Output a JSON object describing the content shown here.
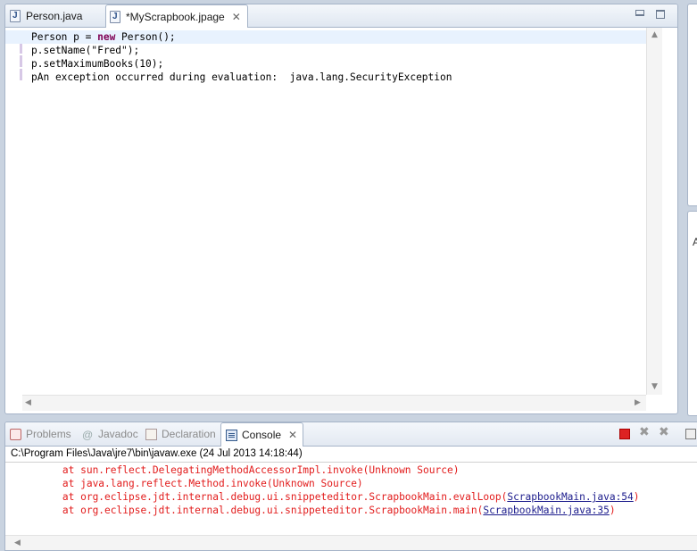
{
  "editor": {
    "tabs": [
      {
        "label": "Person.java",
        "active": false
      },
      {
        "label": "*MyScrapbook.jpage",
        "active": true
      }
    ],
    "code_lines": [
      {
        "before": "Person p = ",
        "keyword": "new",
        "after": " Person();"
      },
      {
        "text": "p.setName(\"Fred\");"
      },
      {
        "text": "p.setMaximumBooks(10);"
      },
      {
        "text": "pAn exception occurred during evaluation:  java.lang.SecurityException"
      }
    ]
  },
  "right_edge": {
    "letter": "A"
  },
  "console_view": {
    "tabs": [
      {
        "label": "Problems",
        "active": false
      },
      {
        "label": "Javadoc",
        "active": false
      },
      {
        "label": "Declaration",
        "active": false
      },
      {
        "label": "Console",
        "active": true
      }
    ],
    "launch_info": "C:\\Program Files\\Java\\jre7\\bin\\javaw.exe (24 Jul 2013 14:18:44)",
    "stack_lines": [
      {
        "prefix": "at sun.reflect.DelegatingMethodAccessorImpl.invoke(Unknown Source)",
        "link": "",
        "suffix": ""
      },
      {
        "prefix": "at java.lang.reflect.Method.invoke(Unknown Source)",
        "link": "",
        "suffix": ""
      },
      {
        "prefix": "at org.eclipse.jdt.internal.debug.ui.snippeteditor.ScrapbookMain.evalLoop(",
        "link": "ScrapbookMain.java:54",
        "suffix": ")"
      },
      {
        "prefix": "at org.eclipse.jdt.internal.debug.ui.snippeteditor.ScrapbookMain.main(",
        "link": "ScrapbookMain.java:35",
        "suffix": ")"
      }
    ],
    "colors": {
      "error_text": "#e21b1b",
      "link_text": "#1c1c8c",
      "terminate": "#dd2222"
    }
  }
}
